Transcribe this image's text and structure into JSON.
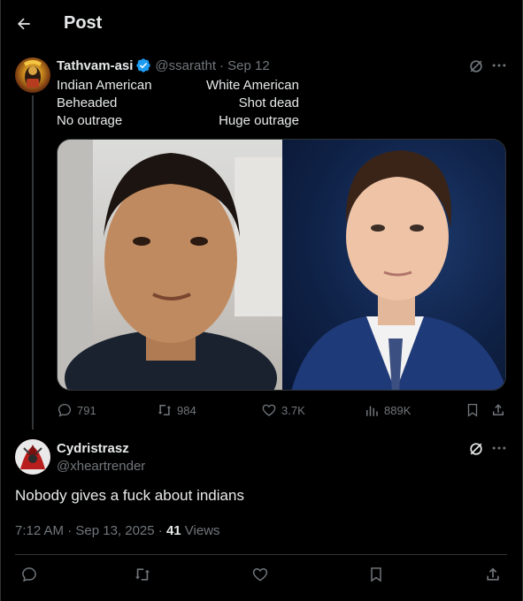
{
  "header": {
    "title": "Post"
  },
  "quoted_post": {
    "author_name": "Tathvam-asi",
    "author_handle": "@ssaratht",
    "date": "· Sep 12",
    "lines": [
      {
        "left": "Indian American",
        "right": "White American"
      },
      {
        "left": "Beheaded",
        "right": "Shot dead"
      },
      {
        "left": "No outrage",
        "right": "Huge outrage"
      }
    ],
    "stats": {
      "replies": "791",
      "reposts": "984",
      "likes": "3.7K",
      "views": "889K"
    }
  },
  "reply": {
    "author_name": "Cydristrasz",
    "author_handle": "@xheartrender",
    "text": "Nobody gives a fuck about indians",
    "timestamp": "7:12 AM · Sep 13, 2025 · ",
    "views_count": "41",
    "views_label": " Views"
  },
  "colors": {
    "background": "#000000",
    "text": "#e7e9ea",
    "muted": "#71767b",
    "divider": "#2f3336",
    "verified": "#1d9bf0"
  }
}
